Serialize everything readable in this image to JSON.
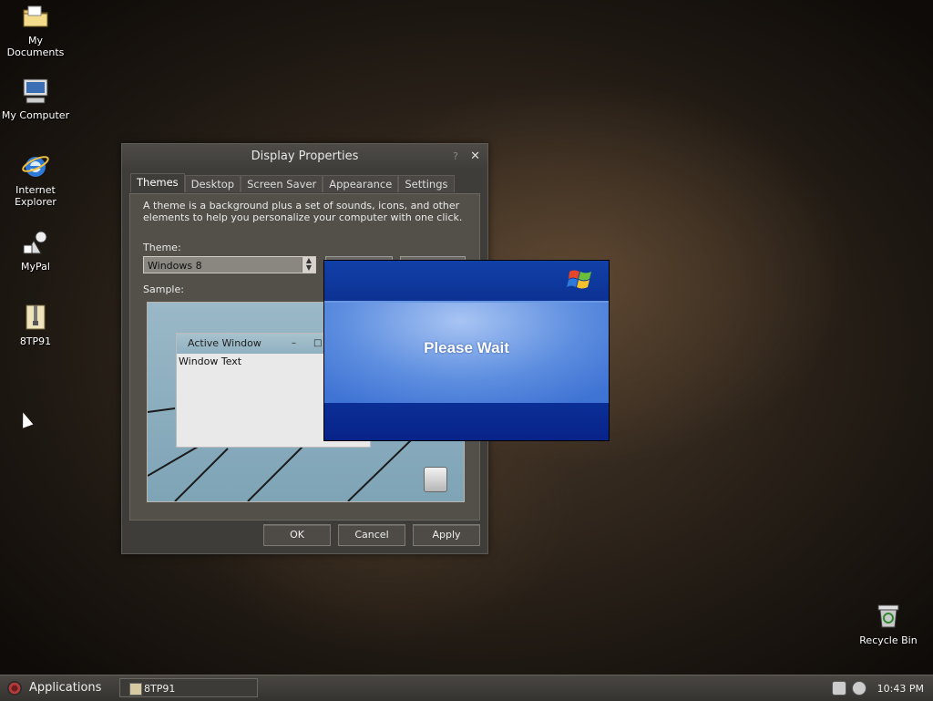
{
  "desktop": {
    "icons": [
      {
        "label": "My Documents",
        "icon": "folder-icon"
      },
      {
        "label": "My Computer",
        "icon": "computer-icon"
      },
      {
        "label": "Internet Explorer",
        "icon": "internet-explorer-icon"
      },
      {
        "label": "MyPal",
        "icon": "mypal-icon"
      },
      {
        "label": "8TP91",
        "icon": "archive-icon"
      }
    ],
    "recycle_bin": {
      "label": "Recycle Bin",
      "icon": "recycle-bin-icon"
    }
  },
  "display_properties": {
    "title": "Display Properties",
    "help_glyph": "?",
    "close_glyph": "✕",
    "tabs": [
      "Themes",
      "Desktop",
      "Screen Saver",
      "Appearance",
      "Settings"
    ],
    "active_tab": "Themes",
    "description": "A theme is a background plus a set of sounds, icons, and other elements to help you personalize your computer with one click.",
    "theme_label": "Theme:",
    "theme_value": "Windows 8",
    "sample_label": "Sample:",
    "sample": {
      "active_window_title": "Active Window",
      "window_text": "Window Text",
      "min_glyph": "–",
      "max_glyph": "□"
    },
    "buttons": {
      "ok": "OK",
      "cancel": "Cancel",
      "apply": "Apply"
    }
  },
  "please_wait": {
    "message": "Please Wait",
    "logo": "windows-flag-icon"
  },
  "taskbar": {
    "applications_label": "Applications",
    "tasks": [
      {
        "label": "8TP91",
        "icon": "archive-icon"
      }
    ],
    "tray_icons": [
      "network-icon",
      "shield-icon"
    ],
    "clock": "10:43 PM"
  }
}
